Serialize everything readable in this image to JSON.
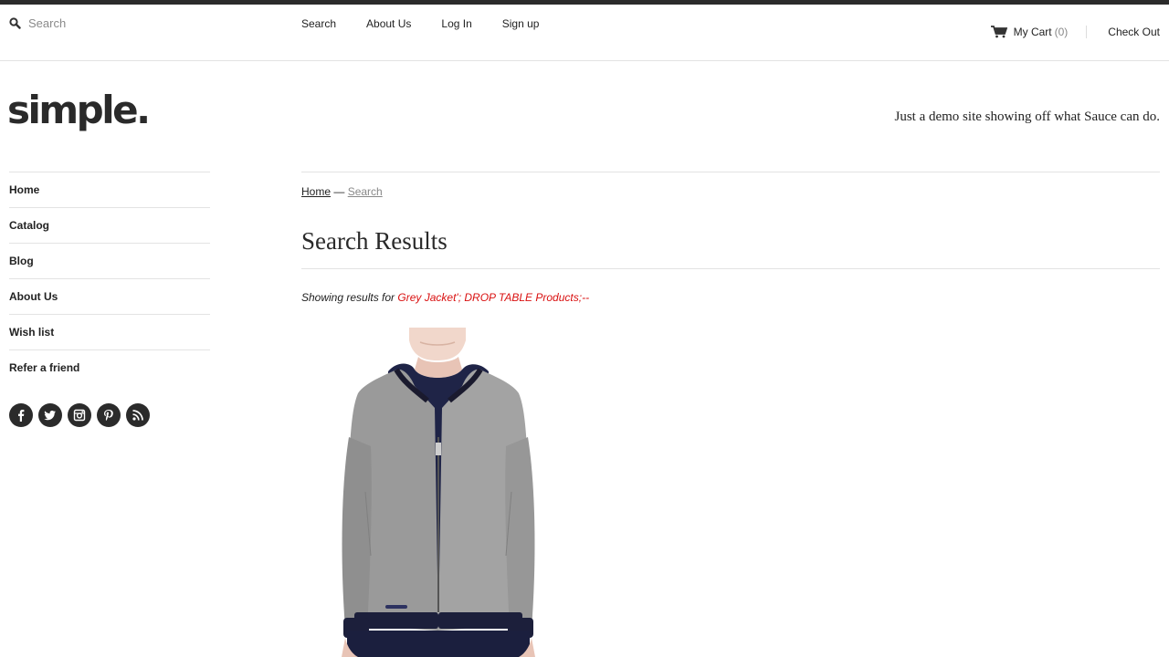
{
  "header": {
    "search": {
      "placeholder": "Search"
    },
    "nav": [
      "Search",
      "About Us",
      "Log In",
      "Sign up"
    ],
    "cart": {
      "label": "My Cart",
      "count": "(0)",
      "checkout": "Check Out"
    }
  },
  "site": {
    "logo": "simple.",
    "tagline": "Just a demo site showing off what Sauce can do."
  },
  "sidebar": {
    "items": [
      {
        "label": "Home"
      },
      {
        "label": "Catalog"
      },
      {
        "label": "Blog"
      },
      {
        "label": "About Us"
      },
      {
        "label": "Wish list"
      },
      {
        "label": "Refer a friend"
      }
    ],
    "social": [
      "facebook-icon",
      "twitter-icon",
      "instagram-icon",
      "pinterest-icon",
      "rss-icon"
    ]
  },
  "main": {
    "breadcrumb": {
      "home": "Home",
      "separator": "—",
      "current": "Search"
    },
    "title": "Search Results",
    "results_prefix": "Showing results for",
    "query": "Grey Jacket'; DROP TABLE Products;--"
  },
  "colors": {
    "accent": "#d91010",
    "topbar": "#2b2b2b"
  }
}
